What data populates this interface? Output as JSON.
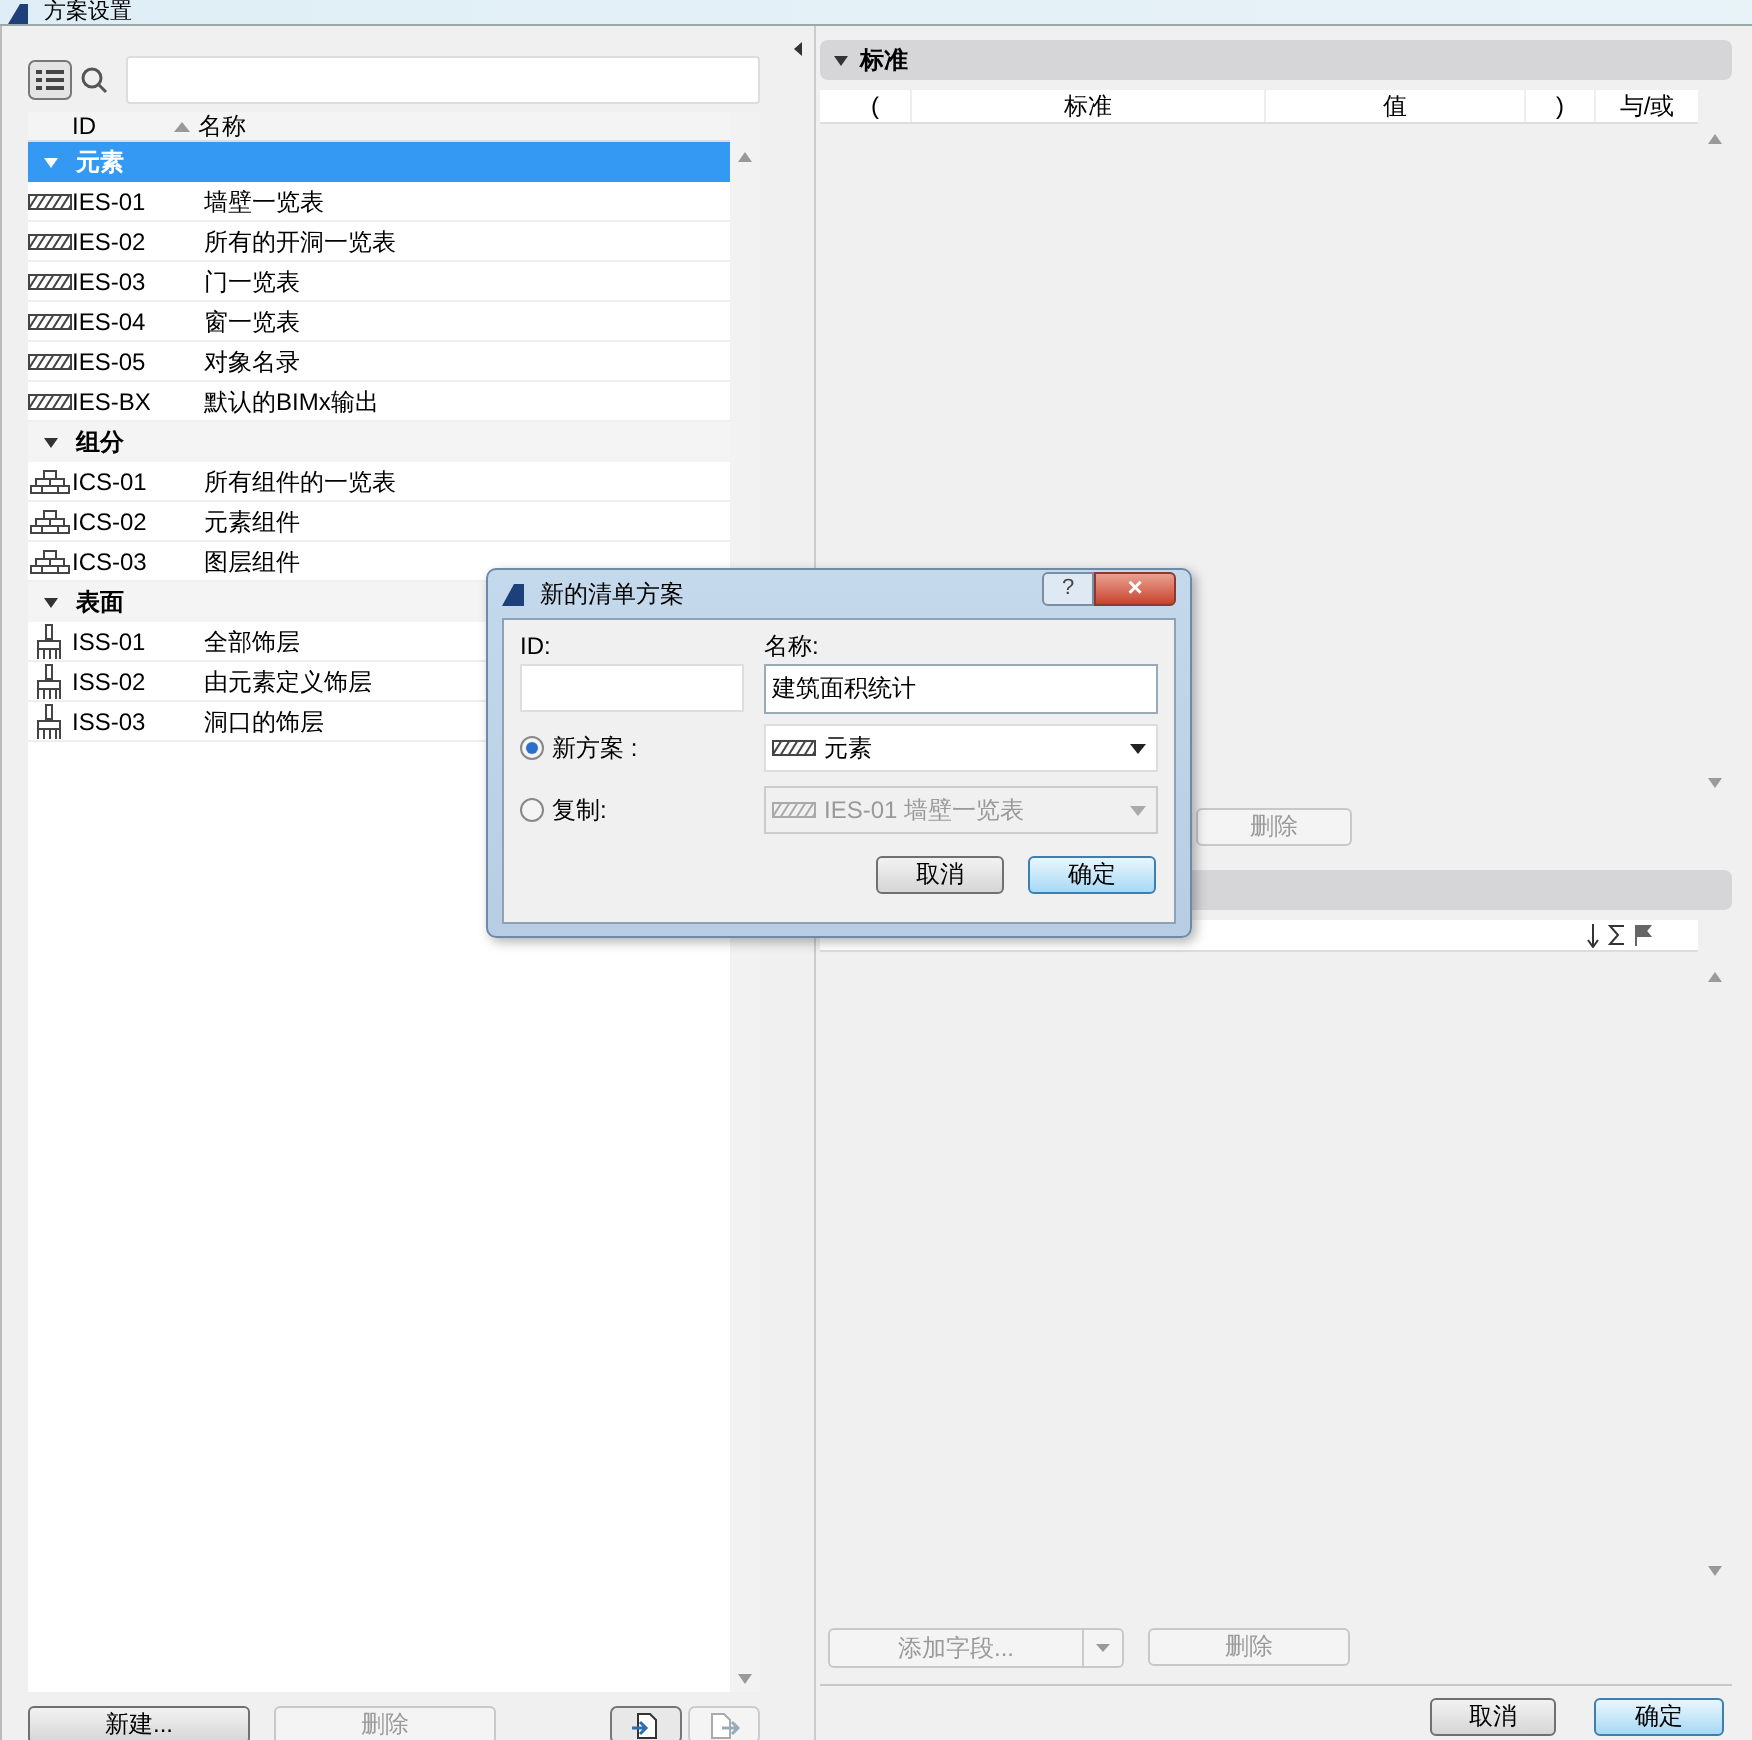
{
  "window": {
    "title": "方案设置"
  },
  "left": {
    "columns": [
      {
        "label": "ID"
      },
      {
        "label": "名称",
        "sorted": true
      }
    ],
    "groups": [
      {
        "label": "元素",
        "selected": true,
        "expanded": true,
        "kind": "hatch",
        "children": [
          {
            "id": "IES-01",
            "name": "墙壁一览表"
          },
          {
            "id": "IES-02",
            "name": "所有的开洞一览表"
          },
          {
            "id": "IES-03",
            "name": "门一览表"
          },
          {
            "id": "IES-04",
            "name": "窗一览表"
          },
          {
            "id": "IES-05",
            "name": "对象名录"
          },
          {
            "id": "IES-BX",
            "name": "默认的BIMx输出"
          }
        ]
      },
      {
        "label": "组分",
        "selected": false,
        "expanded": true,
        "kind": "stack",
        "children": [
          {
            "id": "ICS-01",
            "name": "所有组件的一览表"
          },
          {
            "id": "ICS-02",
            "name": "元素组件"
          },
          {
            "id": "ICS-03",
            "name": "图层组件"
          }
        ]
      },
      {
        "label": "表面",
        "selected": false,
        "expanded": true,
        "kind": "brush",
        "children": [
          {
            "id": "ISS-01",
            "name": "全部饰层"
          },
          {
            "id": "ISS-02",
            "name": "由元素定义饰层"
          },
          {
            "id": "ISS-03",
            "name": "洞口的饰层"
          }
        ]
      }
    ],
    "buttons": [
      {
        "label": "新建...",
        "disabled": false
      },
      {
        "label": "删除",
        "disabled": true
      }
    ]
  },
  "criteria": {
    "title": "标准",
    "columns": [
      "(",
      "标准",
      "值",
      ")",
      "与/或"
    ],
    "delete_button": {
      "label": "删除",
      "disabled": true
    }
  },
  "fields": {
    "add_button": {
      "label": "添加字段...",
      "disabled": true
    },
    "delete_button": {
      "label": "删除",
      "disabled": true
    }
  },
  "footer": {
    "buttons": [
      {
        "label": "取消",
        "default": false
      },
      {
        "label": "确定",
        "default": true
      }
    ]
  },
  "dialog": {
    "title": "新的清单方案",
    "help": "?",
    "close": "×",
    "id_label": "ID:",
    "name_label": "名称:",
    "name_value": "建筑面积统计",
    "options": [
      {
        "label": "新方案 :",
        "selected": true,
        "value": "元素",
        "disabled": false
      },
      {
        "label": "复制:",
        "selected": false,
        "value": "IES-01 墙壁一览表",
        "disabled": true
      }
    ],
    "buttons": [
      {
        "label": "取消",
        "default": false
      },
      {
        "label": "确定",
        "default": true
      }
    ]
  }
}
